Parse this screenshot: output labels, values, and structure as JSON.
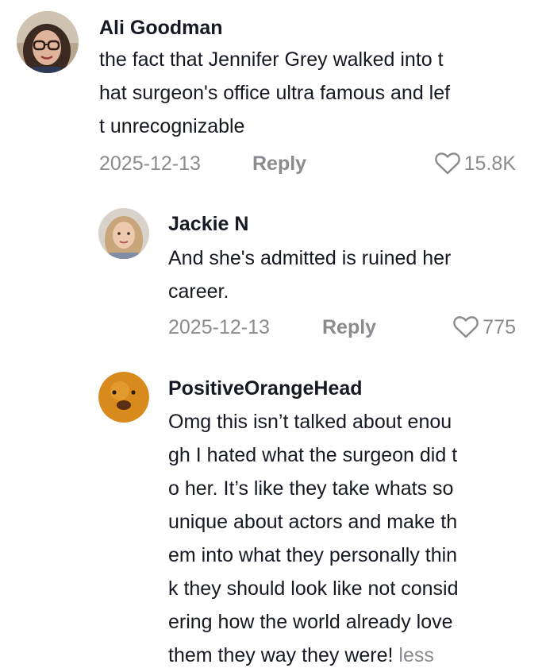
{
  "comments": [
    {
      "author": "Ali Goodman",
      "lines": [
        "the fact that Jennifer Grey walked into t",
        "hat surgeon's office ultra famous and lef",
        "t unrecognizable"
      ],
      "date": "2025-12-13",
      "reply_label": "Reply",
      "likes": "15.8K"
    },
    {
      "author": "Jackie N",
      "lines": [
        "And she's admitted is ruined her",
        "career."
      ],
      "date": "2025-12-13",
      "reply_label": "Reply",
      "likes": "775"
    },
    {
      "author": "PositiveOrangeHead",
      "lines": [
        "Omg this isn’t talked about enou",
        "gh I hated what the surgeon did t",
        "o her. It’s like they take whats so",
        "unique about actors and make th",
        "em into what they personally thin",
        "k they should look like not consid",
        "ering how the world already love",
        "them they way they were!"
      ],
      "less_label": "less"
    }
  ],
  "colors": {
    "text": "#161823",
    "secondary": "#8a8b91",
    "background": "#ffffff"
  },
  "icons": {
    "like": "heart-outline-icon"
  }
}
